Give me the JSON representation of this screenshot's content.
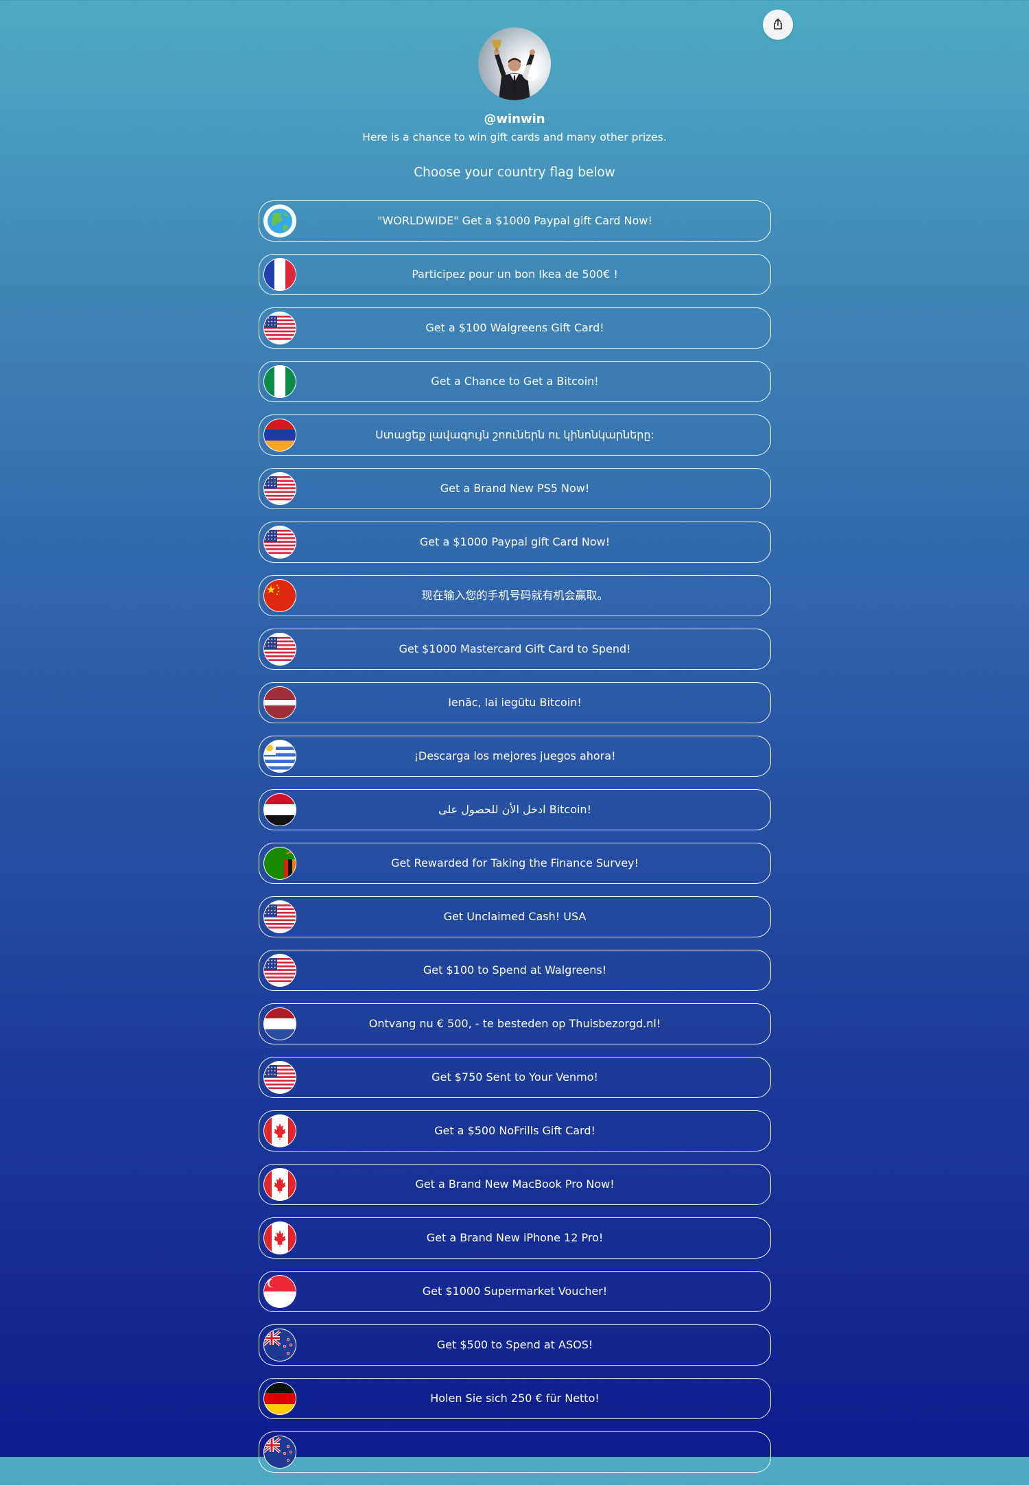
{
  "profile": {
    "username": "@winwin",
    "bio": "Here is a chance to win gift cards and many other prizes."
  },
  "prompt": "Choose your country flag below",
  "share_icon": "share-icon",
  "links": [
    {
      "flag": "globe",
      "label": "\"WORLDWIDE\" Get a $1000 Paypal gift Card Now!"
    },
    {
      "flag": "france",
      "label": "Participez pour un bon Ikea de 500€ !"
    },
    {
      "flag": "usa",
      "label": "Get a $100 Walgreens Gift Card!"
    },
    {
      "flag": "nigeria",
      "label": "Get a Chance to Get a Bitcoin!"
    },
    {
      "flag": "armenia",
      "label": "Ստացեք լավագույն շոուներն ու կինոնկարները:"
    },
    {
      "flag": "usa",
      "label": "Get a Brand New PS5 Now!"
    },
    {
      "flag": "usa",
      "label": "Get a $1000 Paypal gift Card Now!"
    },
    {
      "flag": "china",
      "label": "现在输入您的手机号码就有机会赢取。"
    },
    {
      "flag": "usa",
      "label": "Get $1000 Mastercard Gift Card to Spend!"
    },
    {
      "flag": "latvia",
      "label": "Ienāc, lai iegūtu Bitcoin!"
    },
    {
      "flag": "uruguay",
      "label": "¡Descarga los mejores juegos ahora!"
    },
    {
      "flag": "yemen",
      "label": "ادخل الأن للحصول على Bitcoin!"
    },
    {
      "flag": "zambia",
      "label": "Get Rewarded for Taking the Finance Survey!"
    },
    {
      "flag": "usa",
      "label": "Get Unclaimed Cash! USA"
    },
    {
      "flag": "usa",
      "label": "Get $100 to Spend at Walgreens!"
    },
    {
      "flag": "netherlands",
      "label": "Ontvang nu € 500, - te besteden op Thuisbezorgd.nl!"
    },
    {
      "flag": "usa",
      "label": "Get $750 Sent to Your Venmo!"
    },
    {
      "flag": "canada",
      "label": "Get a $500 NoFrills Gift Card!"
    },
    {
      "flag": "canada",
      "label": "Get a Brand New MacBook Pro Now!"
    },
    {
      "flag": "canada",
      "label": "Get a Brand New iPhone 12 Pro!"
    },
    {
      "flag": "singapore",
      "label": "Get $1000 Supermarket Voucher!"
    },
    {
      "flag": "new-zealand",
      "label": "Get $500 to Spend at ASOS!"
    },
    {
      "flag": "germany",
      "label": "Holen Sie sich 250 € für Netto!"
    },
    {
      "flag": "new-zealand",
      "label": ""
    }
  ]
}
